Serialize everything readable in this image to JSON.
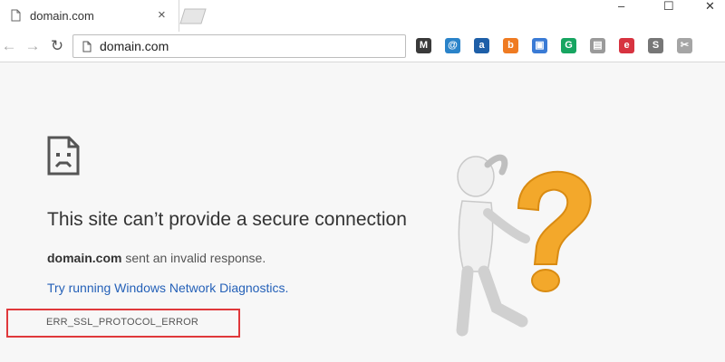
{
  "tab": {
    "title": "domain.com",
    "close_glyph": "×"
  },
  "window_controls": {
    "minimize": "–",
    "maximize": "☐",
    "close": "✕"
  },
  "toolbar": {
    "back_glyph": "←",
    "forward_glyph": "→",
    "reload_glyph": "↻",
    "url": "domain.com",
    "extensions": [
      {
        "name": "m-icon",
        "glyph": "M",
        "color": "#3a3a3a"
      },
      {
        "name": "at-blue-icon",
        "glyph": "@",
        "color": "#2a83c9"
      },
      {
        "name": "at-circle-icon",
        "glyph": "a",
        "color": "#1e5fa8"
      },
      {
        "name": "orange-b-icon",
        "glyph": "b",
        "color": "#ef7b22"
      },
      {
        "name": "screenshot-icon",
        "glyph": "▣",
        "color": "#3a7bd5"
      },
      {
        "name": "grammarly-icon",
        "glyph": "G",
        "color": "#17a561"
      },
      {
        "name": "gray-doc-icon",
        "glyph": "▤",
        "color": "#9a9a9a"
      },
      {
        "name": "red-box-icon",
        "glyph": "e",
        "color": "#d73340"
      },
      {
        "name": "s-circle-icon",
        "glyph": "S",
        "color": "#777777"
      },
      {
        "name": "scissors-icon",
        "glyph": "✂",
        "color": "#a5a5a5"
      }
    ]
  },
  "error": {
    "headline": "This site can’t provide a secure connection",
    "domain": "domain.com",
    "message": " sent an invalid response.",
    "diagnostics_link": "Try running Windows Network Diagnostics.",
    "code": "ERR_SSL_PROTOCOL_ERROR"
  },
  "colors": {
    "highlight_border": "#e0383b",
    "link": "#2561b8",
    "question_mark": "#f3a82b"
  }
}
